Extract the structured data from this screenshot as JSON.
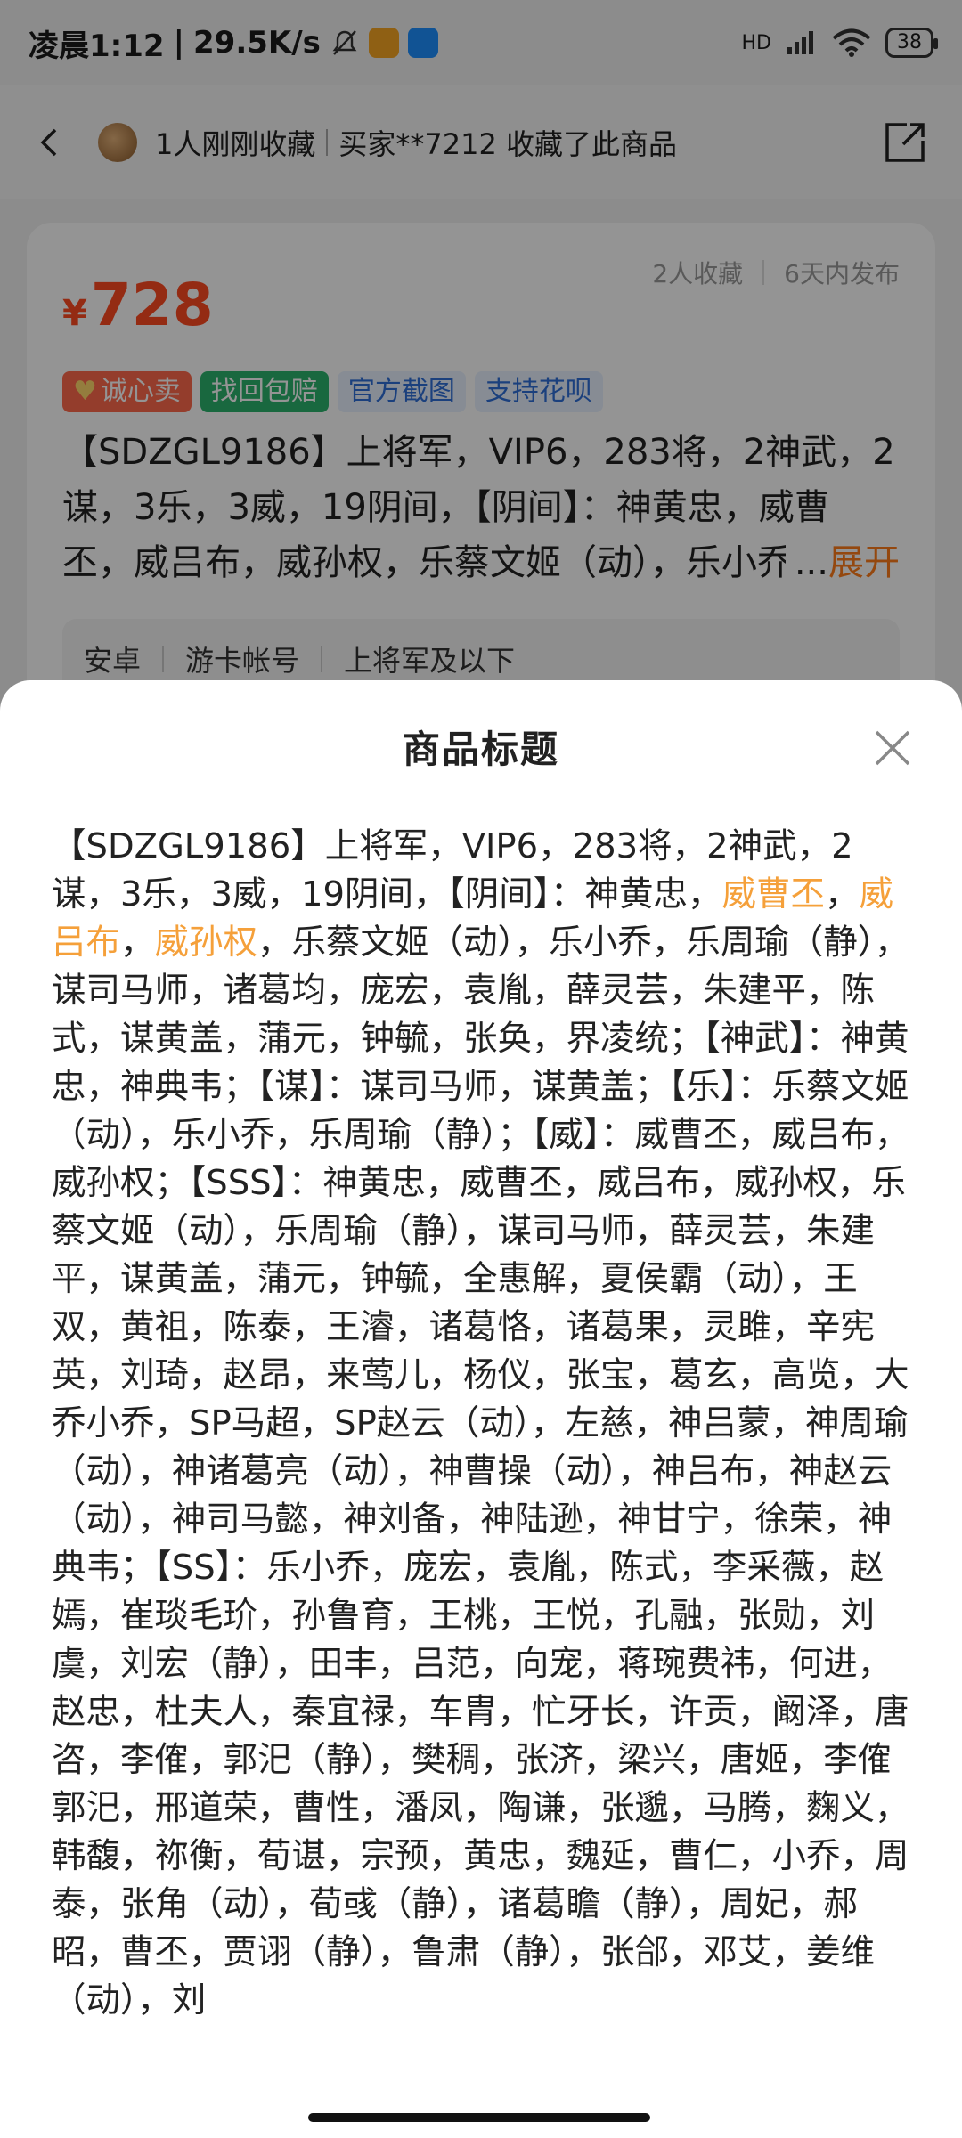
{
  "status_bar": {
    "time": "凌晨1:12",
    "speed": "29.5K/s",
    "signal": "HD",
    "battery": "38"
  },
  "nav": {
    "collected_text": "1人刚刚收藏",
    "buyer_text": "买家**7212 收藏了此商品"
  },
  "product": {
    "favorites": "2人收藏",
    "published": "6天内发布",
    "currency": "¥",
    "price": "728",
    "tags": {
      "sincere": "诚心卖",
      "recover": "找回包赔",
      "official": "官方截图",
      "huabei": "支持花呗"
    },
    "title_preview": "【SDZGL9186】上将军，VIP6，283将，2神武，2谋，3乐，3威，19阴间，【阴间】：神黄忠，威曹丕，威吕布，威孙权，乐蔡文姬（动），乐小乔，",
    "ellipsis": "...",
    "expand_label": "展开",
    "info": {
      "platform": "安卓",
      "account_type": "游卡帐号",
      "rank": "上将军及以下"
    }
  },
  "sheet": {
    "title": "商品标题",
    "segments": [
      "【SDZGL9186】上将军，VIP6，283将，2神武，2谋，3乐，3威，19阴间，【阴间】：神黄忠，",
      "威曹丕",
      "，",
      "威吕布",
      "，",
      "威孙权",
      "，乐蔡文姬（动），乐小乔，乐周瑜（静），谋司马师，诸葛均，庞宏，袁胤，薛灵芸，朱建平，陈式，谋黄盖，蒲元，钟毓，张奂，界凌统；【神武】：神黄忠，神典韦；【谋】：谋司马师，谋黄盖；【乐】：乐蔡文姬（动），乐小乔，乐周瑜（静）；【威】：威曹丕，威吕布，威孙权；【SSS】：神黄忠，威曹丕，威吕布，威孙权，乐蔡文姬（动），乐周瑜（静），谋司马师，薛灵芸，朱建平，谋黄盖，蒲元，钟毓，全惠解，夏侯霸（动），王双，黄祖，陈泰，王濬，诸葛恪，诸葛果，灵雎，辛宪英，刘琦，赵昂，来莺儿，杨仪，张宝，葛玄，高览，大乔小乔，SP马超，SP赵云（动），左慈，神吕蒙，神周瑜（动），神诸葛亮（动），神曹操（动），神吕布，神赵云（动），神司马懿，神刘备，神陆逊，神甘宁，徐荣，神典韦；【SS】：乐小乔，庞宏，袁胤，陈式，李采薇，赵嫣，崔琰毛玠，孙鲁育，王桃，王悦，孔融，张勋，刘虞，刘宏（静），田丰，吕范，向宠，蒋琬费祎，何进，赵忠，杜夫人，秦宜禄，车胄，忙牙长，许贡，阚泽，唐咨，李傕，郭汜（静），樊稠，张济，梁兴，唐姬，李傕郭汜，邢道荣，曹性，潘凤，陶谦，张邈，马腾，麴义，韩馥，祢衡，荀谌，宗预，黄忠，魏延，曹仁，小乔，周泰，张角（动），荀彧（静），诸葛瞻（静），周妃，郝昭，曹丕，贾诩（静），鲁肃（静），张郃，邓艾，姜维（动），刘"
    ]
  }
}
